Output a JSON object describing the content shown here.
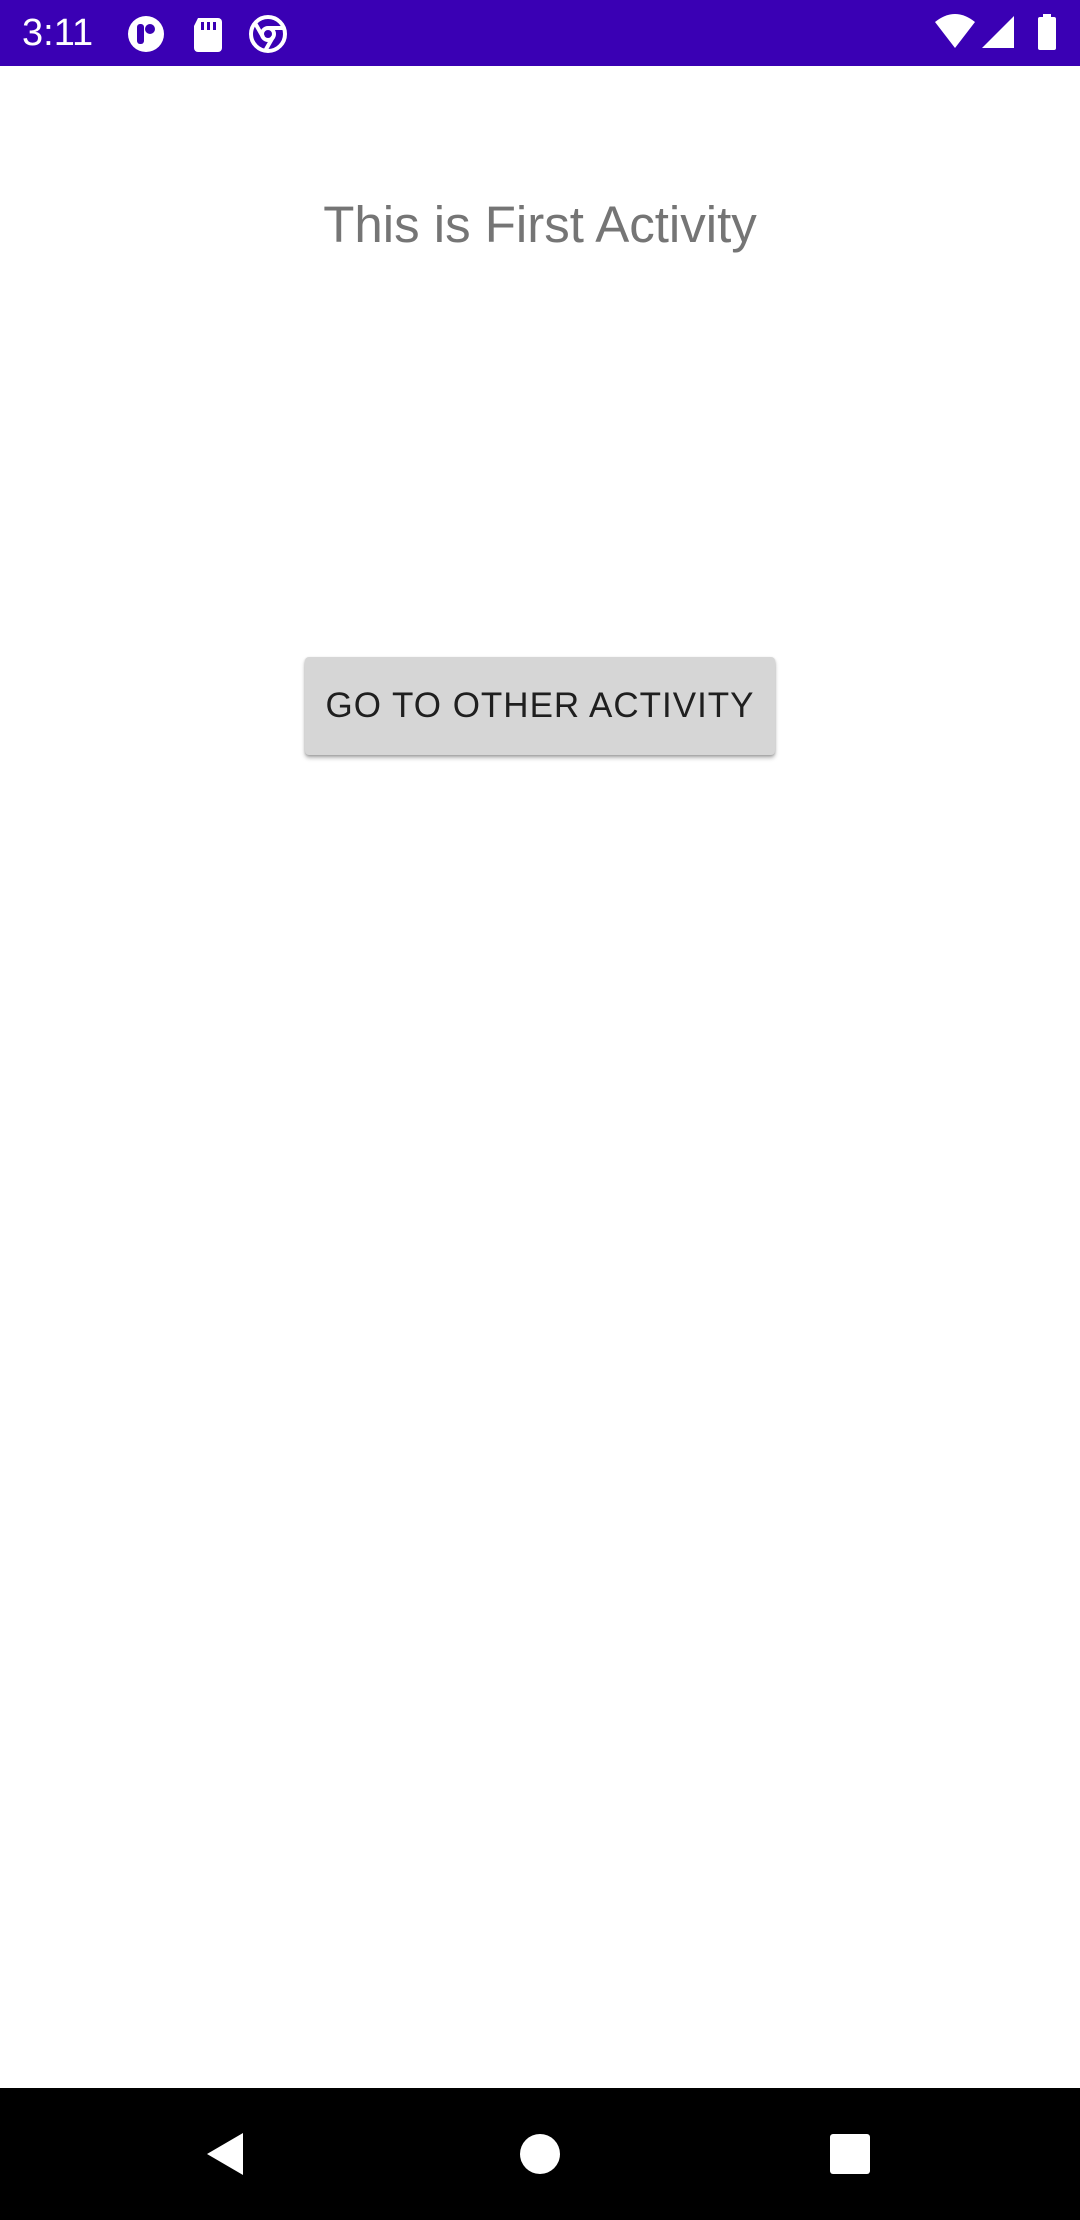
{
  "status_bar": {
    "time": "3:11",
    "background": "#3a00b4",
    "notification_icons": [
      "pocket-casts-icon",
      "sd-card-icon",
      "chrome-icon"
    ],
    "system_icons": [
      "wifi-icon",
      "cell-signal-icon",
      "battery-icon"
    ]
  },
  "main": {
    "title": "This is First Activity",
    "button_label": "GO TO OTHER ACTIVITY"
  },
  "nav_bar": {
    "buttons": [
      "back-icon",
      "home-icon",
      "recents-icon"
    ]
  }
}
